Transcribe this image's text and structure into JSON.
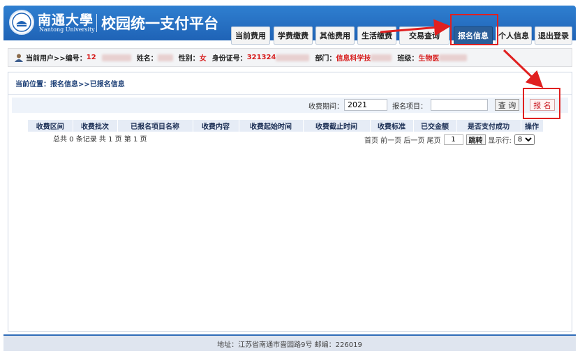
{
  "header": {
    "university_cn": "南通大學",
    "university_en": "Nantong University",
    "platform_title": "校园统一支付平台",
    "nav": [
      {
        "label": "当前费用"
      },
      {
        "label": "学费缴费"
      },
      {
        "label": "其他费用"
      },
      {
        "label": "生活缴费"
      },
      {
        "label": "交易查询"
      },
      {
        "label": "报名信息",
        "active": true
      },
      {
        "label": "个人信息"
      },
      {
        "label": "退出登录"
      }
    ]
  },
  "user_bar": {
    "prefix": "当前用户>>编号：",
    "id_value": "12",
    "name_label": "姓名：",
    "name_value": "",
    "gender_label": "性别：",
    "gender_value": "女",
    "idcard_label": "身份证号：",
    "idcard_value": "321324",
    "dept_label": "部门：",
    "dept_value": "信息科学技",
    "class_label": "班级：",
    "class_value": "生物医"
  },
  "breadcrumb": "当前位置：报名信息>>已报名信息",
  "search": {
    "period_label": "收费期间：",
    "period_value": "2021",
    "item_label": "报名项目：",
    "item_value": "",
    "query_button": "查 询",
    "signup_button": "报 名"
  },
  "table": {
    "columns": [
      "收费区间",
      "收费批次",
      "已报名项目名称",
      "收费内容",
      "收费起始时间",
      "收费截止时间",
      "收费标准",
      "已交金额",
      "是否支付成功",
      "操作"
    ],
    "rows": []
  },
  "pager": {
    "summary": "总共 0 条记录  共 1 页  第 1 页",
    "links": "首页 前一页 后一页 尾页",
    "page_value": "1",
    "jump_label": "跳转",
    "rows_label": "显示行:",
    "rows_value": "8"
  },
  "footer": "地址：江苏省南通市啬园路9号 邮编：226019",
  "colors": {
    "header": "#1f63b6",
    "active_tab": "#2b5f9a",
    "highlight": "#e02020"
  }
}
